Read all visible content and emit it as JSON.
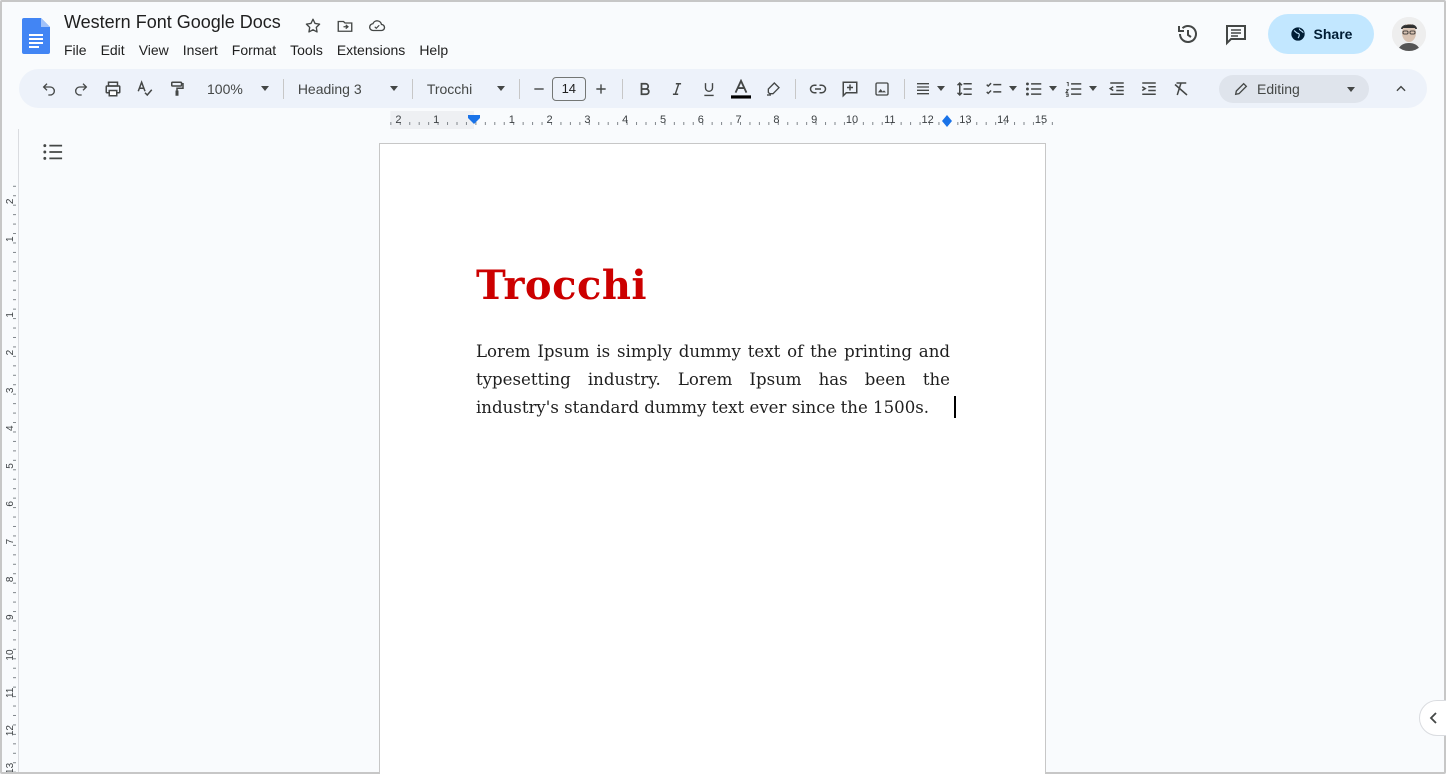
{
  "document": {
    "title": "Western Font Google Docs",
    "heading": "Trocchi",
    "body": "Lorem Ipsum is simply dummy text of the printing and typesetting industry. Lorem Ipsum has been the industry's standard dummy text ever since the 1500s."
  },
  "menu": [
    "File",
    "Edit",
    "View",
    "Insert",
    "Format",
    "Tools",
    "Extensions",
    "Help"
  ],
  "header": {
    "share_label": "Share",
    "icons": [
      "star-icon",
      "move-to-folder-icon",
      "cloud-saved-icon",
      "version-history-icon",
      "comments-icon",
      "globe-icon",
      "avatar"
    ]
  },
  "toolbar": {
    "zoom": "100%",
    "style": "Heading 3",
    "font": "Trocchi",
    "font_size": "14",
    "mode": "Editing"
  },
  "rulers": {
    "horizontal_labels": [
      "2",
      "1",
      "1",
      "2",
      "3",
      "4",
      "5",
      "6",
      "7",
      "8",
      "9",
      "10",
      "11",
      "12",
      "13",
      "14",
      "15"
    ],
    "vertical_labels": [
      "2",
      "1",
      "1",
      "2",
      "3",
      "4",
      "5",
      "6",
      "7",
      "8",
      "9",
      "10",
      "11",
      "12",
      "13",
      "14"
    ]
  },
  "colors": {
    "heading": "#cc0000",
    "share_bg": "#c2e7ff",
    "docs_blue": "#4285f4",
    "toolbar_bg": "#edf2fa"
  }
}
